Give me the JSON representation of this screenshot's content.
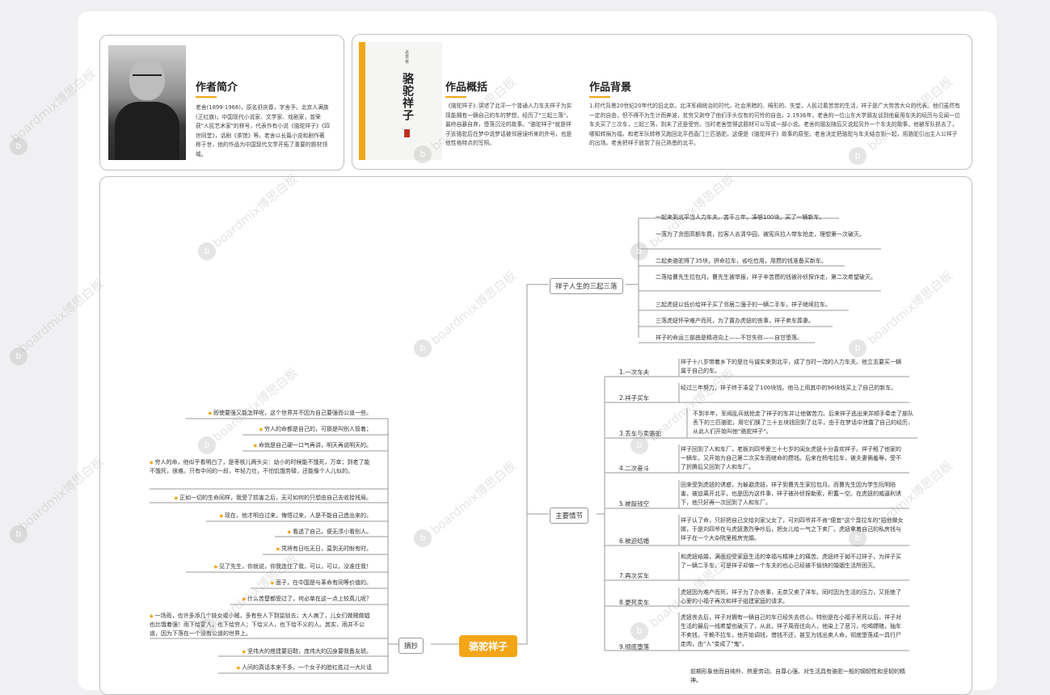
{
  "author": {
    "title": "作者简介",
    "bio": "老舍(1899-1966)，原名舒庆春，字舍予。北京人满族(正红旗)，中国现代小说家、文学家、戏剧家，曾荣获\"人民艺术家\"的称号，代表作有小说《骆驼祥子》《四世同堂》，话剧《茶馆》等。老舍以长篇小说和剧作著称于世，他的作品为中国现代文学开拓了重要的题材领域。"
  },
  "book": {
    "cover_title": "骆驼祥子",
    "cover_sub": "老舍 著"
  },
  "summary": {
    "title": "作品概括",
    "text": "《骆驼祥子》讲述了北平一个普通人力车夫祥子为实现能拥有一辆自己的车的梦想，经历了\"三起三落\"，最终自暴自弃，堕落沉沦的故事。\"骆驼祥子\"就是祥子去骆驼后在梦中说梦话被邻居误听来的外号，也是他性格特点的写照。"
  },
  "background": {
    "title": "作品背景",
    "text": "1.时代背景20世纪20年代的旧北京。北洋军阀统治的时代。社会黑暗的、畸形的、失望，人民过着苦苦的生活，祥子是广大劳苦大众的代表。他们虽然有一定的自由，但不得不为生计而奔波，贫穷又剥夺了他们手头仅有的可怜的自由。2.1936年，老舍的一位山东大学朋友谈到他雇用车夫的经历与见闻一位车夫买了三次车，三起三落，到末了还是受穷。当时老舍觉得这题材可以写成一部小说。老舍的朋友随后又说起另外一个车夫的故事，他被军队抓去了，哪知转祸为福，和老军队转移又跑回北平西直门三匹骆驼，这便是《骆驼祥子》故事的原型。老舍决定把骆驼与车夫结合到一起，用骆驼引出主人公祥子的出场。老舍把祥子放到了自己熟悉的北平。"
  },
  "mindmap": {
    "root": "骆驼祥子",
    "branch_rise_fall": "祥子人生的三起三落",
    "rise_fall": [
      "一起来到北平当人力车夫，苦干三年，凑够100块，买了一辆新车。",
      "一落为了贪图高额车费，拉客人去清华园，被宪兵拉人带车抢走，理想第一次破灭。",
      "二起卖骆驼得了35块，拼命拉车，省吃俭用，用攒的钱准备买新车。",
      "二落给曹先生拉包月，曹先生被举报，祥子辛苦攒的钱被孙侦探诈走，第二次希望破灭。",
      "三起虎妞以低价给祥子买了邻居二强子的一辆二手车，祥子继续拉车。",
      "三落虎妞怀孕难产而死，为了置办虎妞的丧事，祥子卖车葬妻。",
      "祥子的命运三部曲是精进向上——不甘失败——自甘堕落。"
    ],
    "branch_plot": "主要情节",
    "plot": [
      {
        "n": "1.一次车夫",
        "t": "祥子十八岁带着乡下的是壮与诚实来到北平，成了当时一流的人力车夫。他立志要买一辆属于自己的车。"
      },
      {
        "n": "2.祥子买车",
        "t": "经过三年努力，祥子终于凑足了100块钱。他马上用其中的96块钱买上了自己的新车。"
      },
      {
        "n": "3.丢车与卖骆驼",
        "t": "不到半年，军阀乱兵就抢走了祥子的车并让他做苦力。后来祥子逃出来并顺手牵走了部队丢下的三匹骆驼，用它们换了三十五块钱回到了北平，由于在梦话中泄露了自己的经历，从此人们开始叫他\"骆驼祥子\"。"
      },
      {
        "n": "4.二次奋斗",
        "t": "祥子回到了人和车厂，老板刘四爷爱三十七岁的闺女虎妞十分喜欢祥子。祥子租了他家的一辆车，又开始为自己第二次买车而继命的攒钱。后来在杨宅拉车，被夫妻俩羞辱，受不了折腾后又回到了人和车厂。"
      },
      {
        "n": "5.被敲钱空",
        "t": "回来受到虎妞的诱惑，为躲避虎妞，祥子到曹先生家拉包月。而曹先生因为学生阮明陷害，被迫离开北平，也是因为这件事，祥子被孙侦探勒索，积蓄一空。在虎妞的威逼利诱下，他只好再一次回到了人和车厂。"
      },
      {
        "n": "6.被迫结婚",
        "t": "祥子认了命，只好把自己交给刘家父女了，可刘四爷并不肯\"便宜\"这个臭拉车的\"招他做女婿，于是刘四爷在与虎妞激烈争吵后，把女儿给一气之下卖厂。虎妞拿着自己的私房钱与祥子在一个大杂院里租房完婚。"
      },
      {
        "n": "7.再次买车",
        "t": "和虎妞结婚，满面迎受家庭生活的幸福与精神上的痛苦。虎妞终于拗不过祥子，为祥子买了一辆二手车，可是祥子却做一个车夫的也心已经被不愉快的婚姻生活所困灭。"
      },
      {
        "n": "8.更死卖车",
        "t": "虎妞因为难产而死，祥子为了办丧事，无奈又卖了洋车。同时因为生活的压力，又拒绝了心爱的小福子再次和祥子组建家庭的请求。"
      },
      {
        "n": "9.彻底堕落",
        "t": "虎妞丧去后，祥子对拥有一辆自己的车已经失去信心，特别是在小福子吊死以后，祥子对生活的最后一线希望也破灭了，从此，祥子周而往向人，他染上了恶习，吃喝嫖赌，抽车不卖钱，干赖不拉车，他开始调钱，借钱不还，甚至为钱出卖人命，彻底堕落成一具行尸走肉，由\"人\"变成了\"鬼\"。"
      },
      {
        "n": "",
        "t": "前期形象他而自纯朴、热爱劳动、自尊心强、对生活具有骆驼一般的钢韧性和坚韧的精神。"
      }
    ],
    "branch_excerpt": "摘抄",
    "excerpts": [
      "即使要强又能怎样呢，这个世界并不因为自己要强而公道一些。",
      "穷人的命都是自己的，可那是叫别人管着；",
      "命就是自己硬一口气再讲，明天再说明天的。",
      "穷人的命，他似乎看明白了，是枣核儿两头尖：幼小的时候能不饿死，万幸；到老了能不饿死，很难。只有中间的一段，年轻力壮，不怕饥饿劳碌，还能像个人儿似的。",
      "正如一切的生命同样，我受了损害之后，无可如何的只想由自己去收拾残局。",
      "现在，他才明白过来，悔悟过来，人是不能自己造出来的。",
      "看透了自己，便无须小看别人。",
      "凭将有日吃无日，莫到无时盼有时。",
      "见了先生，你就说，你我连住了我，可以，可以，没准住我！",
      "面子，在中国是与革命有同等价值的。",
      "什么苦楚都受过了，何必单在这一点上较真儿呢？",
      "一场雨，也许多添几个妓女或小贼，多有些人下到监狱去；大人病了，儿女们做贼做娼也比饿着强！雨下给富人，也下给穷人；下给义人，也下给不义的人。其实，雨并不公道，因为下落在一个没有公道的世界上。",
      "坚伟大的搭建要旧鞋，庞伟大的囚身要我备友琥。",
      "人间的真话本来不多，一个女子的脸红胜过一大片话"
    ]
  },
  "watermark": "boardmix博思白板",
  "accent": "#f2a516"
}
